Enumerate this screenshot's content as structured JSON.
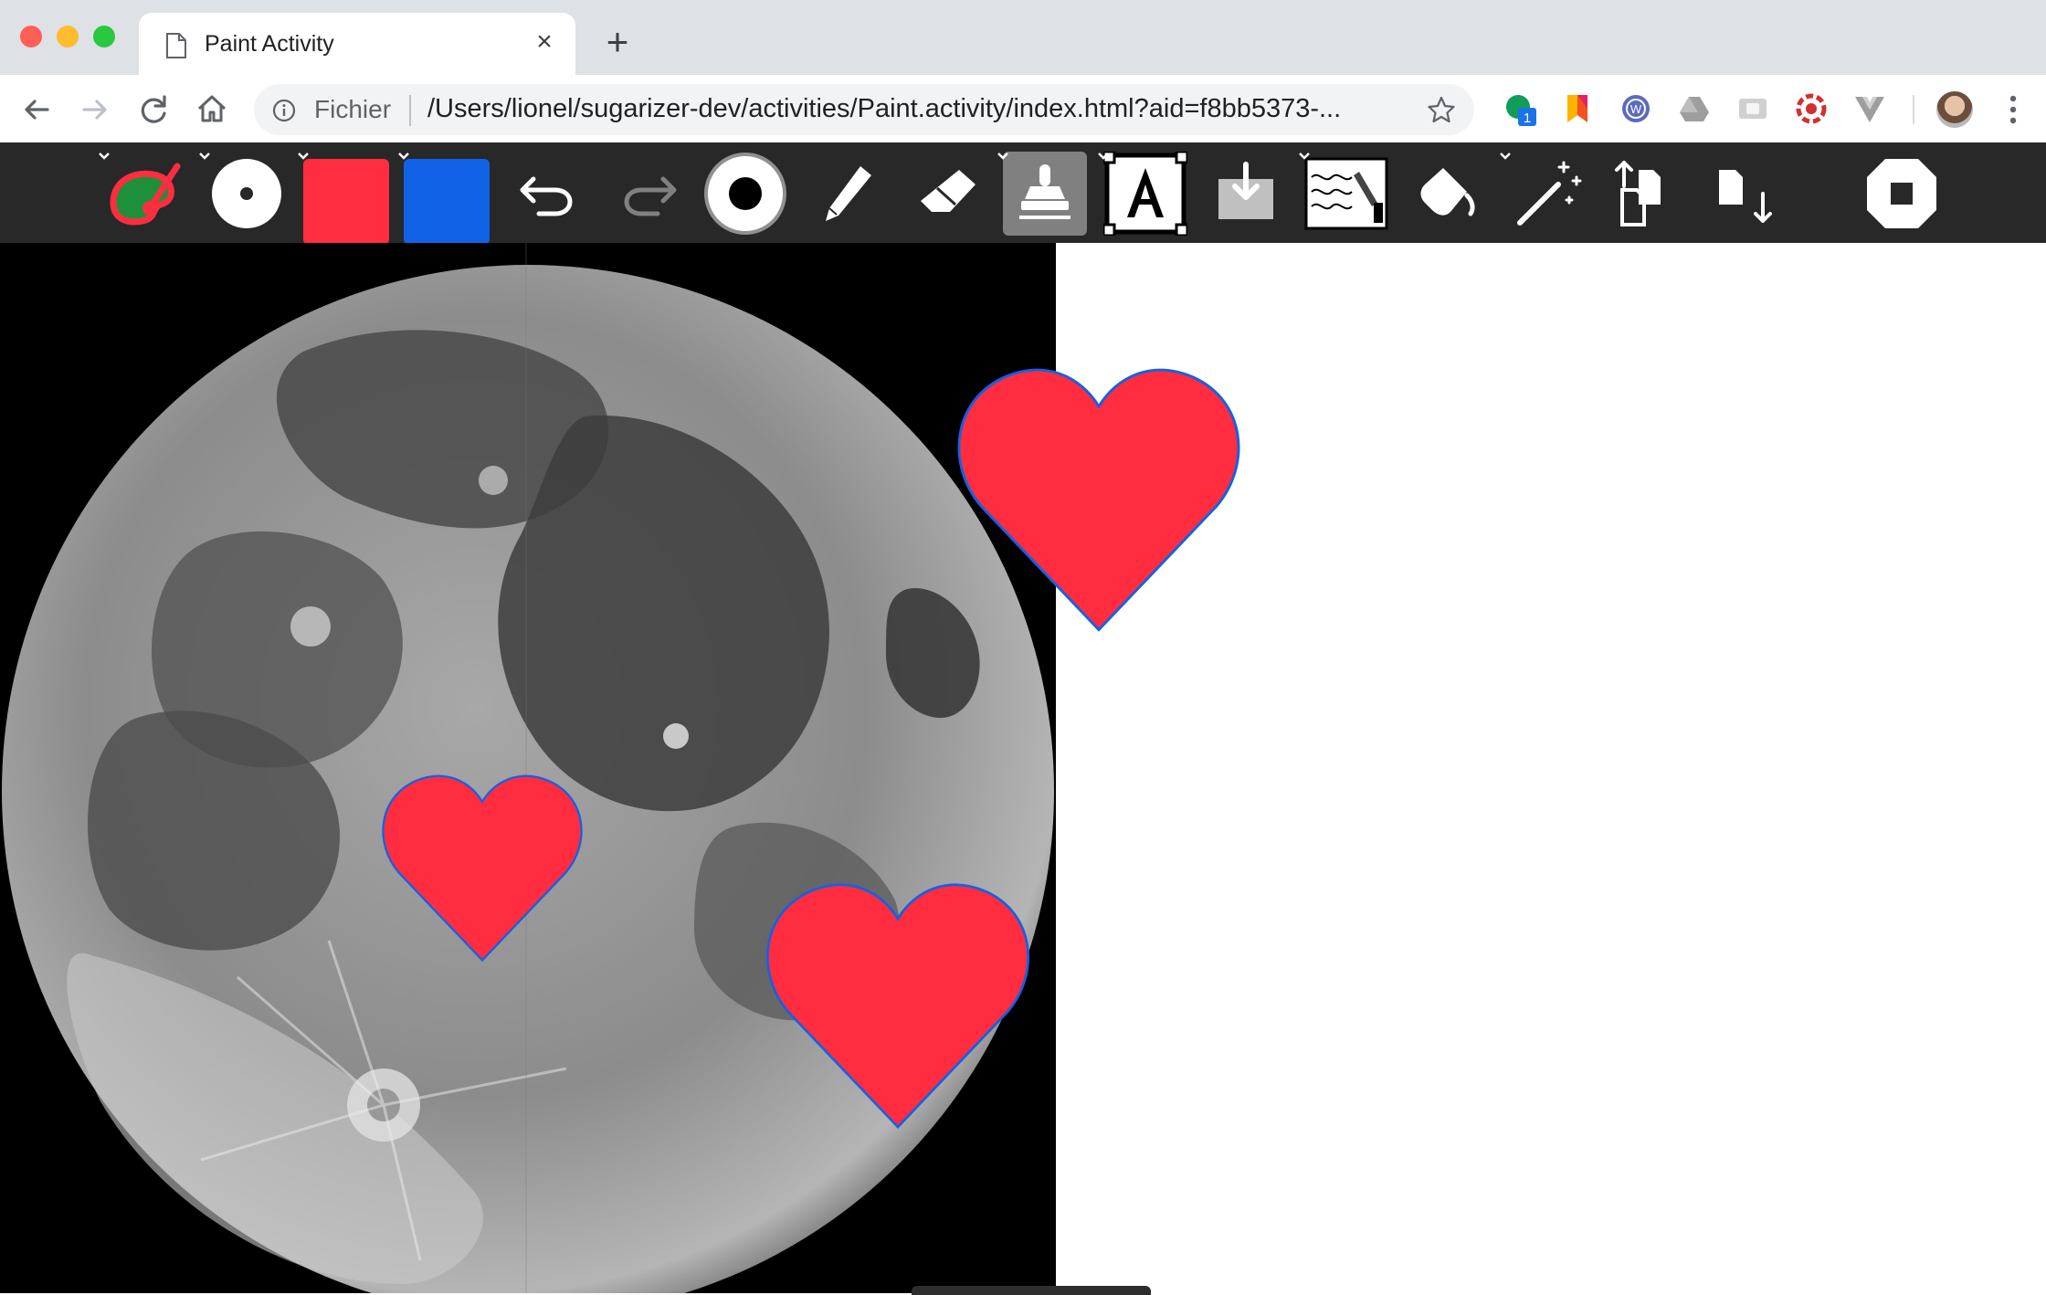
{
  "browser": {
    "tab": {
      "title": "Paint Activity",
      "close": "×"
    },
    "new_tab": "+",
    "omnibox": {
      "scheme_label": "Fichier",
      "url": "/Users/lionel/sugarizer-dev/activities/Paint.activity/index.html?aid=f8bb5373-..."
    },
    "extensions": [
      "hangouts-icon",
      "bookmark-manager-icon",
      "web-extension-icon",
      "drive-icon",
      "cast-icon",
      "lastpass-icon",
      "vue-devtools-icon"
    ],
    "extension_badge": "1"
  },
  "toolbar": {
    "tools": [
      "activity-icon",
      "brush-size-icon",
      "fill-color",
      "stroke-color",
      "undo-icon",
      "redo-icon",
      "size-icon",
      "pen-icon",
      "eraser-icon",
      "stamp-icon",
      "text-icon",
      "insert-image-icon",
      "filters-icon",
      "bucket-icon",
      "effects-icon",
      "copy-icon",
      "paste-icon",
      "stop-icon"
    ],
    "fill_color": "#ff2d3f",
    "stroke_color": "#1162e6",
    "active_tool": "stamp-icon"
  },
  "canvas": {
    "background_color": "#ffffff",
    "image": "full-moon-photo",
    "heart_fill": "#ff2d3f",
    "heart_stroke": "#1162e6",
    "stamp_count": 3
  }
}
